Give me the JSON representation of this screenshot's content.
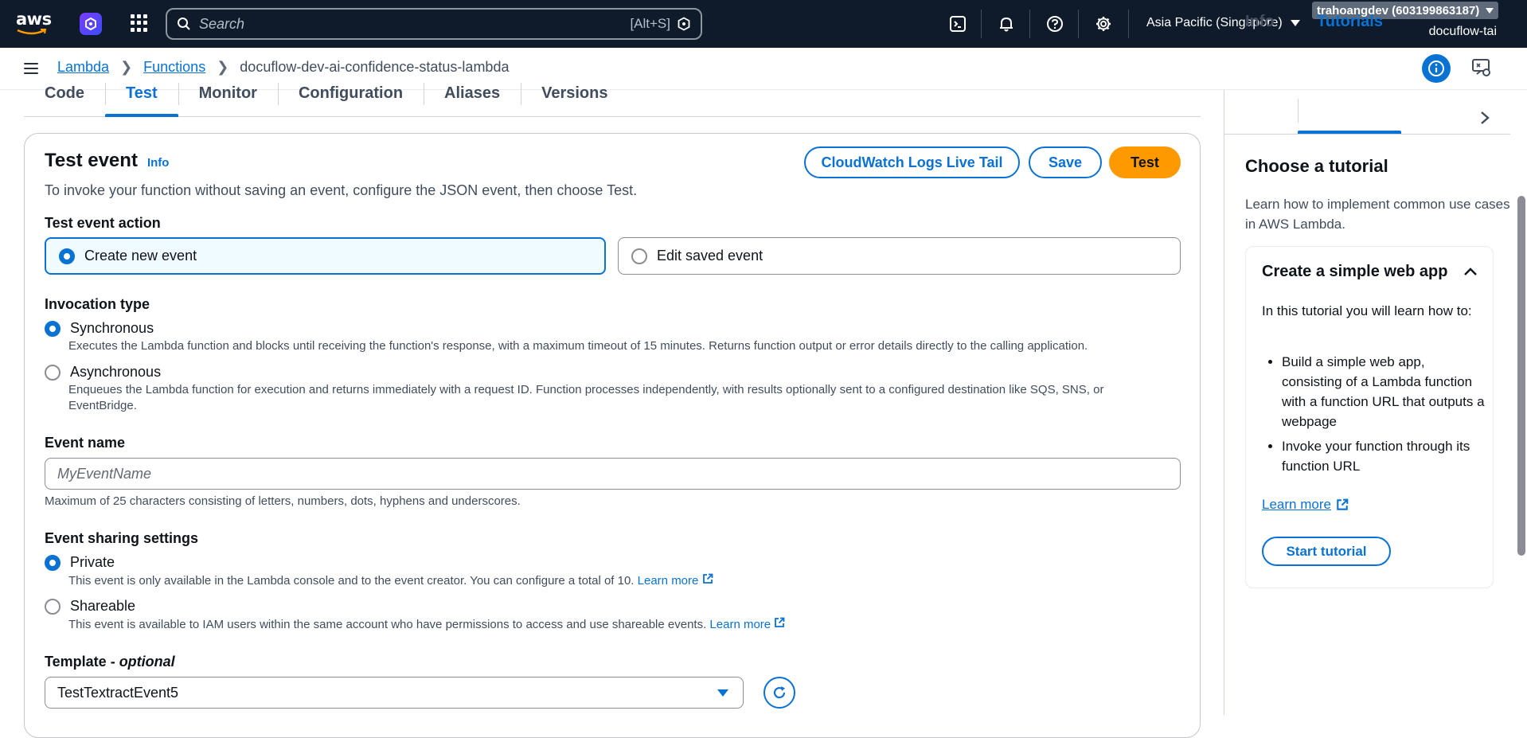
{
  "topnav": {
    "logo": "aws",
    "search_placeholder": "Search",
    "search_shortcut": "[Alt+S]",
    "region": "Asia Pacific (Singapore)",
    "account": "trahoangdev (603199863187)",
    "user": "docuflow-tai"
  },
  "breadcrumb": {
    "items": [
      "Lambda",
      "Functions"
    ],
    "current": "docuflow-dev-ai-confidence-status-lambda"
  },
  "tabs": [
    "Code",
    "Test",
    "Monitor",
    "Configuration",
    "Aliases",
    "Versions"
  ],
  "active_tab": "Test",
  "test_event": {
    "title": "Test event",
    "info": "Info",
    "description": "To invoke your function without saving an event, configure the JSON event, then choose Test.",
    "buttons": {
      "live_tail": "CloudWatch Logs Live Tail",
      "save": "Save",
      "test": "Test"
    },
    "action_label": "Test event action",
    "action_options": [
      "Create new event",
      "Edit saved event"
    ],
    "action_selected": "Create new event",
    "invocation_label": "Invocation type",
    "invocation_options": [
      {
        "label": "Synchronous",
        "desc": "Executes the Lambda function and blocks until receiving the function's response, with a maximum timeout of 15 minutes. Returns function output or error details directly to the calling application.",
        "selected": true
      },
      {
        "label": "Asynchronous",
        "desc": "Enqueues the Lambda function for execution and returns immediately with a request ID. Function processes independently, with results optionally sent to a configured destination like SQS, SNS, or EventBridge.",
        "selected": false
      }
    ],
    "event_name_label": "Event name",
    "event_name_placeholder": "MyEventName",
    "event_name_value": "",
    "event_name_hint": "Maximum of 25 characters consisting of letters, numbers, dots, hyphens and underscores.",
    "sharing_label": "Event sharing settings",
    "sharing_options": [
      {
        "label": "Private",
        "desc": "This event is only available in the Lambda console and to the event creator. You can configure a total of 10.",
        "link": "Learn more",
        "selected": true
      },
      {
        "label": "Shareable",
        "desc": "This event is available to IAM users within the same account who have permissions to access and use shareable events.",
        "link": "Learn more",
        "selected": false
      }
    ],
    "template_label": "Template",
    "template_optional": "optional",
    "template_value": "TestTextractEvent5"
  },
  "help_panel": {
    "tabs": [
      "Info",
      "Tutorials"
    ],
    "active_tab": "Tutorials",
    "heading": "Choose a tutorial",
    "description": "Learn how to implement common use cases in AWS Lambda.",
    "card": {
      "title": "Create a simple web app",
      "intro": "In this tutorial you will learn how to:",
      "bullets": [
        "Build a simple web app, consisting of a Lambda function with a function URL that outputs a webpage",
        "Invoke your function through its function URL"
      ],
      "link": "Learn more",
      "button": "Start tutorial"
    }
  },
  "colors": {
    "nav_bg": "#0f1b2a",
    "link_blue": "#0972d3",
    "primary_orange": "#ff9900"
  }
}
